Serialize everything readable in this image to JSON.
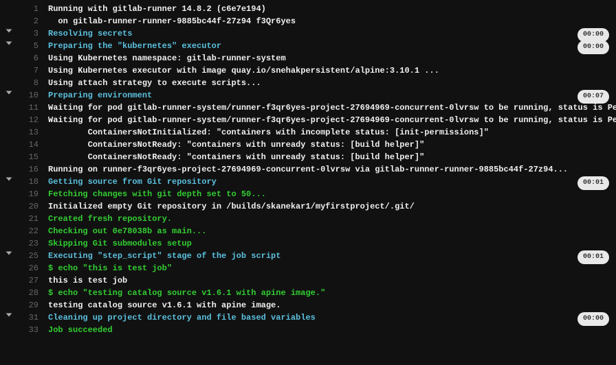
{
  "lines": [
    {
      "n": 1,
      "chev": false,
      "cls": "c-white",
      "text": "Running with gitlab-runner 14.8.2 (c6e7e194)"
    },
    {
      "n": 2,
      "chev": false,
      "cls": "c-white",
      "text": "  on gitlab-runner-runner-9885bc44f-27z94 f3Qr6yes"
    },
    {
      "n": 3,
      "chev": true,
      "cls": "c-cyan",
      "text": "Resolving secrets",
      "dur": "00:00"
    },
    {
      "n": 5,
      "chev": true,
      "cls": "c-cyan",
      "text": "Preparing the \"kubernetes\" executor",
      "dur": "00:00"
    },
    {
      "n": 6,
      "chev": false,
      "cls": "c-white",
      "text": "Using Kubernetes namespace: gitlab-runner-system"
    },
    {
      "n": 7,
      "chev": false,
      "cls": "c-white",
      "text": "Using Kubernetes executor with image quay.io/snehakpersistent/alpine:3.10.1 ..."
    },
    {
      "n": 8,
      "chev": false,
      "cls": "c-white",
      "text": "Using attach strategy to execute scripts..."
    },
    {
      "n": 10,
      "chev": true,
      "cls": "c-cyan",
      "text": "Preparing environment",
      "dur": "00:07"
    },
    {
      "n": 11,
      "chev": false,
      "cls": "c-white",
      "text": "Waiting for pod gitlab-runner-system/runner-f3qr6yes-project-27694969-concurrent-0lvrsw to be running, status is Pending"
    },
    {
      "n": 12,
      "chev": false,
      "cls": "c-white",
      "text": "Waiting for pod gitlab-runner-system/runner-f3qr6yes-project-27694969-concurrent-0lvrsw to be running, status is Pending"
    },
    {
      "n": 13,
      "chev": false,
      "cls": "c-white",
      "text": "        ContainersNotInitialized: \"containers with incomplete status: [init-permissions]\""
    },
    {
      "n": 14,
      "chev": false,
      "cls": "c-white",
      "text": "        ContainersNotReady: \"containers with unready status: [build helper]\""
    },
    {
      "n": 15,
      "chev": false,
      "cls": "c-white",
      "text": "        ContainersNotReady: \"containers with unready status: [build helper]\""
    },
    {
      "n": 16,
      "chev": false,
      "cls": "c-white",
      "text": "Running on runner-f3qr6yes-project-27694969-concurrent-0lvrsw via gitlab-runner-runner-9885bc44f-27z94..."
    },
    {
      "n": 18,
      "chev": true,
      "cls": "c-cyan",
      "text": "Getting source from Git repository",
      "dur": "00:01"
    },
    {
      "n": 19,
      "chev": false,
      "cls": "c-green",
      "text": "Fetching changes with git depth set to 50..."
    },
    {
      "n": 20,
      "chev": false,
      "cls": "c-white",
      "text": "Initialized empty Git repository in /builds/skanekar1/myfirstproject/.git/"
    },
    {
      "n": 21,
      "chev": false,
      "cls": "c-green",
      "text": "Created fresh repository."
    },
    {
      "n": 22,
      "chev": false,
      "cls": "c-green",
      "text": "Checking out 0e78038b as main..."
    },
    {
      "n": 23,
      "chev": false,
      "cls": "c-green",
      "text": "Skipping Git submodules setup"
    },
    {
      "n": 25,
      "chev": true,
      "cls": "c-cyan",
      "text": "Executing \"step_script\" stage of the job script",
      "dur": "00:01"
    },
    {
      "n": 26,
      "chev": false,
      "cls": "c-green",
      "text": "$ echo \"this is test job\""
    },
    {
      "n": 27,
      "chev": false,
      "cls": "c-white",
      "text": "this is test job"
    },
    {
      "n": 28,
      "chev": false,
      "cls": "c-green",
      "text": "$ echo \"testing catalog source v1.6.1 with apine image.\""
    },
    {
      "n": 29,
      "chev": false,
      "cls": "c-white",
      "text": "testing catalog source v1.6.1 with apine image."
    },
    {
      "n": 31,
      "chev": true,
      "cls": "c-cyan",
      "text": "Cleaning up project directory and file based variables",
      "dur": "00:00"
    },
    {
      "n": 33,
      "chev": false,
      "cls": "c-green",
      "text": "Job succeeded"
    }
  ]
}
